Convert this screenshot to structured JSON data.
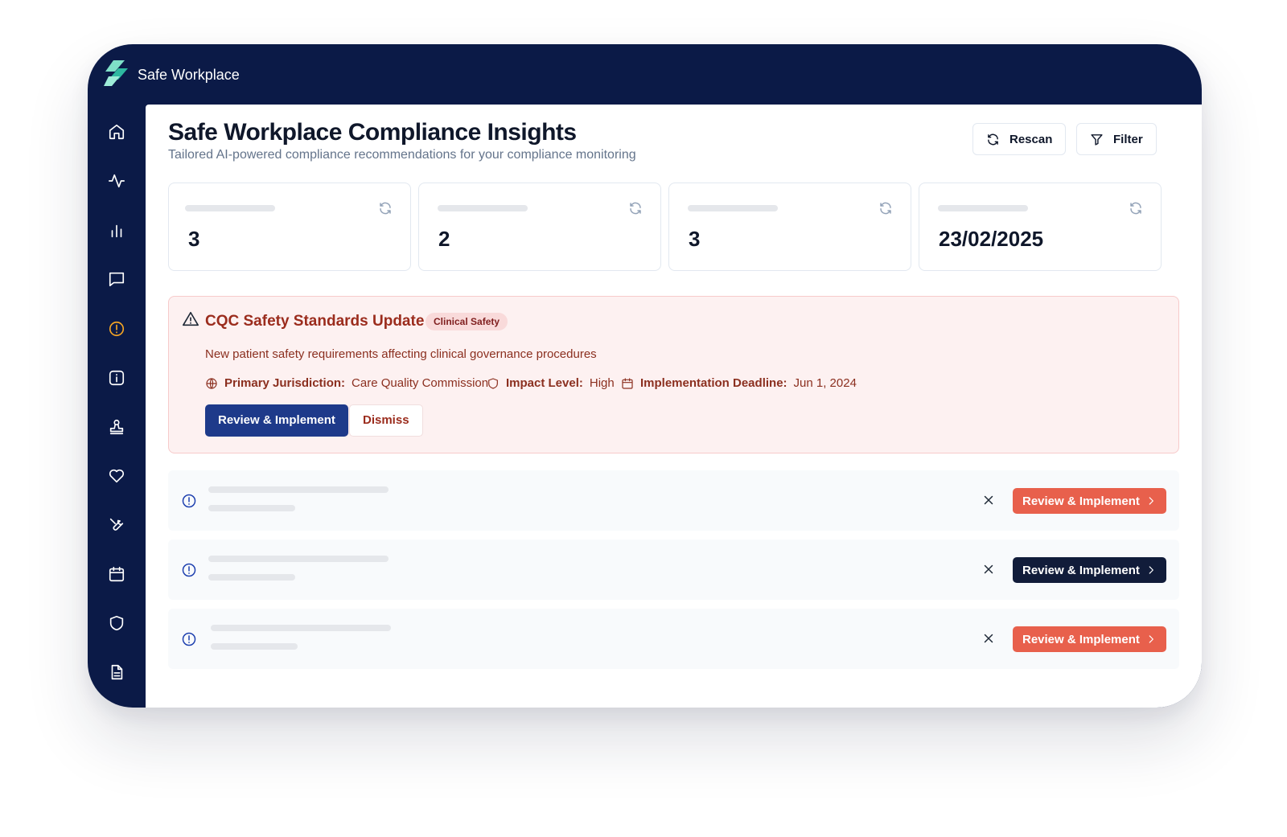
{
  "app": {
    "title": "Safe Workplace"
  },
  "sidebar": {
    "items": [
      {
        "icon": "home-icon"
      },
      {
        "icon": "activity-icon"
      },
      {
        "icon": "bar-chart-icon"
      },
      {
        "icon": "message-icon"
      },
      {
        "icon": "alert-circle-icon",
        "active": true
      },
      {
        "icon": "info-icon"
      },
      {
        "icon": "stamp-icon"
      },
      {
        "icon": "heart-icon"
      },
      {
        "icon": "wrench-icon"
      },
      {
        "icon": "calendar-icon"
      },
      {
        "icon": "shield-icon"
      },
      {
        "icon": "document-icon"
      }
    ],
    "active_color": "#f5a524"
  },
  "header": {
    "title": "Safe Workplace Compliance Insights",
    "subtitle": "Tailored AI-powered compliance recommendations for your compliance monitoring",
    "rescan_label": "Rescan",
    "filter_label": "Filter"
  },
  "stats": [
    {
      "value": "3"
    },
    {
      "value": "2"
    },
    {
      "value": "3"
    },
    {
      "value": "23/02/2025"
    }
  ],
  "alert": {
    "title": "CQC Safety Standards Update",
    "tag": "Clinical Safety",
    "description": "New patient safety requirements affecting clinical governance procedures",
    "jurisdiction_label": "Primary Jurisdiction:",
    "jurisdiction_value": "Care Quality Commission",
    "impact_label": "Impact Level:",
    "impact_value": "High",
    "deadline_label": "Implementation Deadline:",
    "deadline_value": "Jun 1, 2024",
    "primary_label": "Review & Implement",
    "dismiss_label": "Dismiss"
  },
  "recommendations": [
    {
      "button_label": "Review & Implement",
      "button_color": "#e8604c"
    },
    {
      "button_label": "Review & Implement",
      "button_color": "#111c3a"
    },
    {
      "button_label": "Review & Implement",
      "button_color": "#e8604c"
    }
  ],
  "colors": {
    "navy": "#0b1a47",
    "primary": "#1e3a8a",
    "alert_bg": "#fdf1f1",
    "alert_text": "#9b2c1d"
  }
}
